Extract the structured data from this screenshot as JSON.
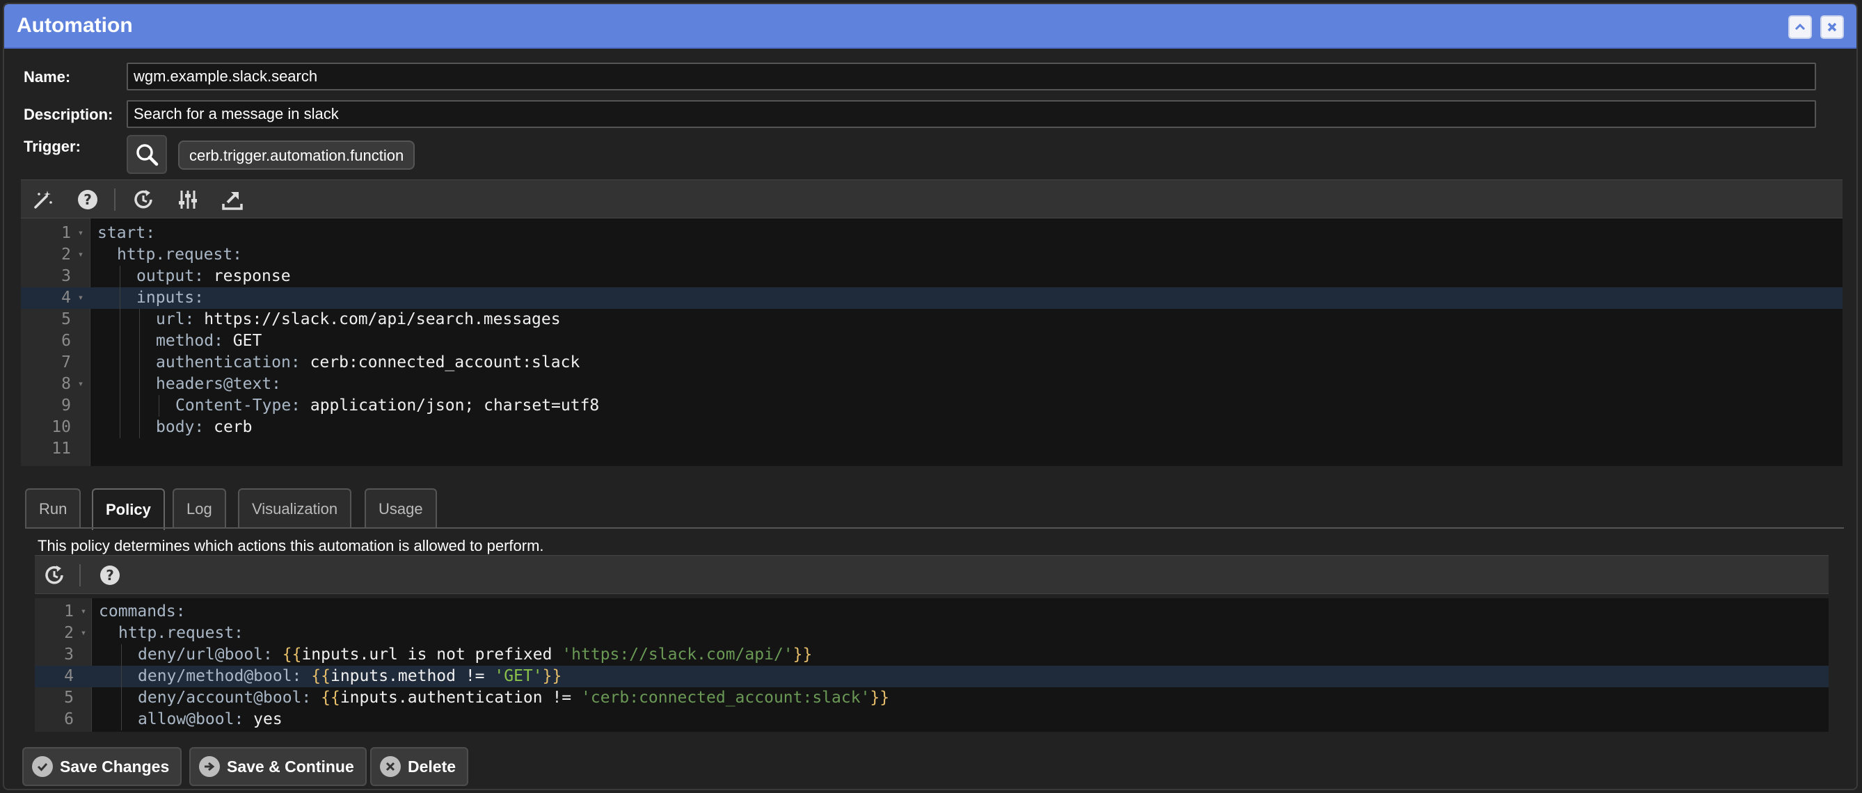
{
  "dialog": {
    "title": "Automation"
  },
  "form": {
    "name_label": "Name:",
    "name_value": "wgm.example.slack.search",
    "description_label": "Description:",
    "description_value": "Search for a message in slack",
    "trigger_label": "Trigger:",
    "trigger_value": "cerb.trigger.automation.function"
  },
  "editor": {
    "toolbar_icons": [
      "magic-wand-icon",
      "help-icon",
      "history-icon",
      "sliders-icon",
      "export-icon"
    ],
    "active_line": 4,
    "lines": [
      {
        "num": "1",
        "fold": true,
        "indent": 0,
        "tokens": [
          {
            "t": "start:",
            "c": "key"
          }
        ]
      },
      {
        "num": "2",
        "fold": true,
        "indent": 1,
        "tokens": [
          {
            "t": "http.request:",
            "c": "key"
          }
        ]
      },
      {
        "num": "3",
        "fold": false,
        "indent": 2,
        "tokens": [
          {
            "t": "output:",
            "c": "key"
          },
          {
            "t": " response",
            "c": "val"
          }
        ]
      },
      {
        "num": "4",
        "fold": true,
        "indent": 2,
        "tokens": [
          {
            "t": "inputs:",
            "c": "key"
          }
        ]
      },
      {
        "num": "5",
        "fold": false,
        "indent": 3,
        "tokens": [
          {
            "t": "url:",
            "c": "key"
          },
          {
            "t": " https://slack.com/api/search.messages",
            "c": "val"
          }
        ]
      },
      {
        "num": "6",
        "fold": false,
        "indent": 3,
        "tokens": [
          {
            "t": "method:",
            "c": "key"
          },
          {
            "t": " GET",
            "c": "val"
          }
        ]
      },
      {
        "num": "7",
        "fold": false,
        "indent": 3,
        "tokens": [
          {
            "t": "authentication:",
            "c": "key"
          },
          {
            "t": " cerb:connected_account:slack",
            "c": "val"
          }
        ]
      },
      {
        "num": "8",
        "fold": true,
        "indent": 3,
        "tokens": [
          {
            "t": "headers@text:",
            "c": "key"
          }
        ]
      },
      {
        "num": "9",
        "fold": false,
        "indent": 4,
        "tokens": [
          {
            "t": "Content-Type:",
            "c": "key"
          },
          {
            "t": " application/json; charset=utf8",
            "c": "val"
          }
        ]
      },
      {
        "num": "10",
        "fold": false,
        "indent": 3,
        "tokens": [
          {
            "t": "body:",
            "c": "key"
          },
          {
            "t": " cerb",
            "c": "val"
          }
        ]
      },
      {
        "num": "11",
        "fold": false,
        "indent": 0,
        "tokens": []
      }
    ]
  },
  "tabs": [
    {
      "label": "Run",
      "active": false
    },
    {
      "label": "Policy",
      "active": true
    },
    {
      "label": "Log",
      "active": false
    },
    {
      "label": "Visualization",
      "active": false
    },
    {
      "label": "Usage",
      "active": false
    }
  ],
  "policy": {
    "description": "This policy determines which actions this automation is allowed to perform.",
    "toolbar_icons": [
      "history-icon",
      "help-icon"
    ],
    "active_line": 4,
    "lines": [
      {
        "num": "1",
        "fold": true,
        "indent": 0,
        "tokens": [
          {
            "t": "commands:",
            "c": "key"
          }
        ]
      },
      {
        "num": "2",
        "fold": true,
        "indent": 1,
        "tokens": [
          {
            "t": "http.request:",
            "c": "key"
          }
        ]
      },
      {
        "num": "3",
        "fold": false,
        "indent": 2,
        "tokens": [
          {
            "t": "deny/url@bool:",
            "c": "key"
          },
          {
            "t": " ",
            "c": "val"
          },
          {
            "t": "{{",
            "c": "brace"
          },
          {
            "t": "inputs.url is not prefixed ",
            "c": "val"
          },
          {
            "t": "'https://slack.com/api/'",
            "c": "str"
          },
          {
            "t": "}}",
            "c": "brace"
          }
        ]
      },
      {
        "num": "4",
        "fold": false,
        "indent": 2,
        "tokens": [
          {
            "t": "deny/method@bool:",
            "c": "key"
          },
          {
            "t": " ",
            "c": "val"
          },
          {
            "t": "{{",
            "c": "brace"
          },
          {
            "t": "inputs.method != ",
            "c": "val"
          },
          {
            "t": "'GET'",
            "c": "strg"
          },
          {
            "t": "}}",
            "c": "brace"
          }
        ]
      },
      {
        "num": "5",
        "fold": false,
        "indent": 2,
        "tokens": [
          {
            "t": "deny/account@bool:",
            "c": "key"
          },
          {
            "t": " ",
            "c": "val"
          },
          {
            "t": "{{",
            "c": "brace"
          },
          {
            "t": "inputs.authentication != ",
            "c": "val"
          },
          {
            "t": "'cerb:connected_account:slack'",
            "c": "str"
          },
          {
            "t": "}}",
            "c": "brace"
          }
        ]
      },
      {
        "num": "6",
        "fold": false,
        "indent": 2,
        "tokens": [
          {
            "t": "allow@bool:",
            "c": "key"
          },
          {
            "t": " yes",
            "c": "val"
          }
        ]
      }
    ]
  },
  "actions": {
    "save_label": "Save Changes",
    "save_continue_label": "Save & Continue",
    "delete_label": "Delete"
  }
}
